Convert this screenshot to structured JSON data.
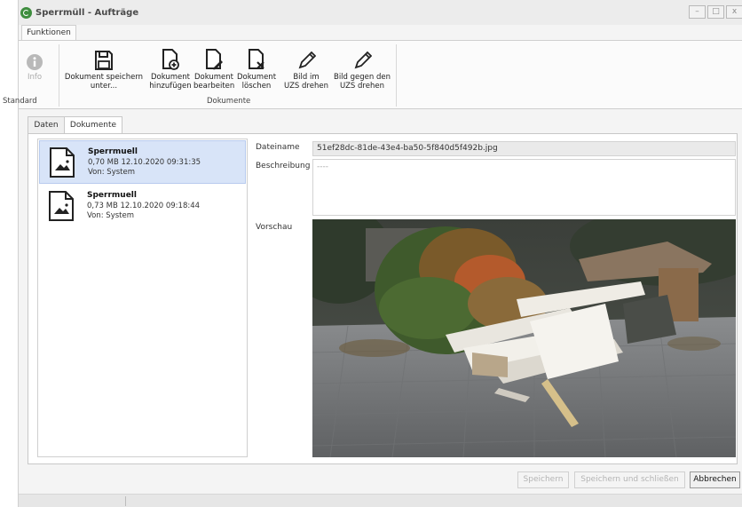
{
  "window": {
    "title": "Sperrmüll - Aufträge",
    "controls": {
      "minimize": "–",
      "maximize": "□",
      "close": "x"
    }
  },
  "ribbon": {
    "tab": "Funktionen",
    "groups": {
      "standard": "Standard",
      "dokumente": "Dokumente"
    },
    "buttons": {
      "info": {
        "line1": "Info",
        "enabled": false
      },
      "save_under": {
        "line1": "Dokument speichern",
        "line2": "unter..."
      },
      "add": {
        "line1": "Dokument",
        "line2": "hinzufügen"
      },
      "edit": {
        "line1": "Dokument",
        "line2": "bearbeiten"
      },
      "delete": {
        "line1": "Dokument",
        "line2": "löschen"
      },
      "rotate_cw": {
        "line1": "Bild im",
        "line2": "UZS drehen"
      },
      "rotate_ccw": {
        "line1": "Bild gegen den",
        "line2": "UZS drehen"
      }
    }
  },
  "tabs": {
    "daten": "Daten",
    "dokumente": "Dokumente",
    "active": "Dokumente"
  },
  "documents": [
    {
      "name": "Sperrmuell",
      "meta": "0,70 MB  12.10.2020 09:31:35",
      "by": "Von: System",
      "selected": true
    },
    {
      "name": "Sperrmuell",
      "meta": "0,73 MB  12.10.2020 09:18:44",
      "by": "Von: System",
      "selected": false
    }
  ],
  "detail": {
    "dateiname_label": "Dateiname",
    "dateiname_value": "51ef28dc-81de-43e4-ba50-5f840d5f492b.jpg",
    "beschreibung_label": "Beschreibung",
    "beschreibung_value": "----",
    "vorschau_label": "Vorschau"
  },
  "footer": {
    "speichern": "Speichern",
    "speichern_schliessen": "Speichern und schließen",
    "abbrechen": "Abbrechen"
  },
  "colors": {
    "selected_row": "#d8e4f8",
    "app_icon": "#3e8d3e"
  }
}
